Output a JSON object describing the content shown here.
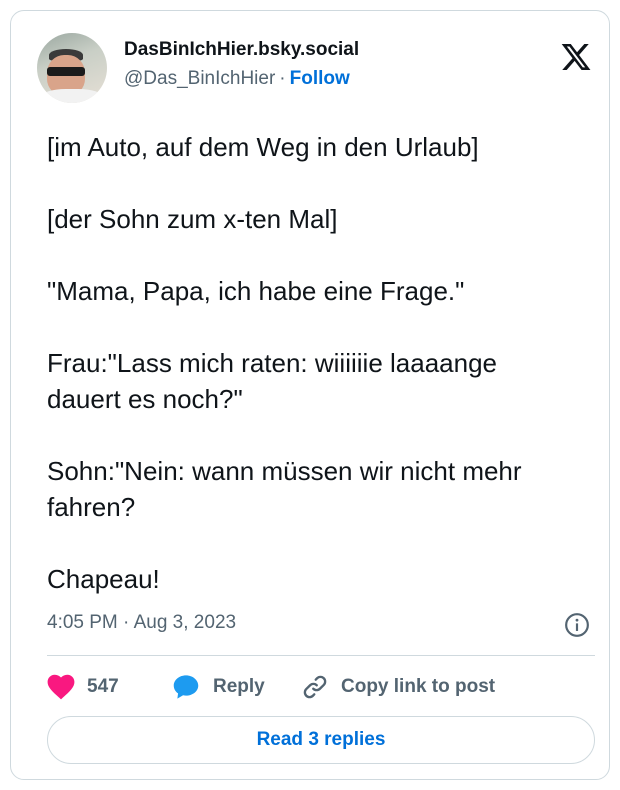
{
  "author": {
    "display_name": "DasBinIchHier.bsky.social",
    "handle": "@Das_BinIchHier",
    "separator": "·",
    "follow_label": "Follow"
  },
  "platform_logo": "x-logo-icon",
  "post": {
    "text": "[im Auto, auf dem Weg in den Urlaub]\n\n[der Sohn zum x-ten Mal]\n\n\"Mama, Papa, ich habe eine Frage.\"\n\nFrau:\"Lass mich raten: wiiiiiie laaaange\ndauert es noch?\"\n\nSohn:\"Nein: wann müssen wir nicht mehr\nfahren?\n\nChapeau!",
    "timestamp": "4:05 PM · Aug 3, 2023"
  },
  "actions": {
    "like_count": "547",
    "reply_label": "Reply",
    "copy_label": "Copy link to post"
  },
  "read_replies_label": "Read 3 replies",
  "colors": {
    "like": "#f91880",
    "accent": "#0070d9",
    "reply_icon": "#1d9bf0",
    "muted": "#536471",
    "border": "#cfd9de"
  }
}
